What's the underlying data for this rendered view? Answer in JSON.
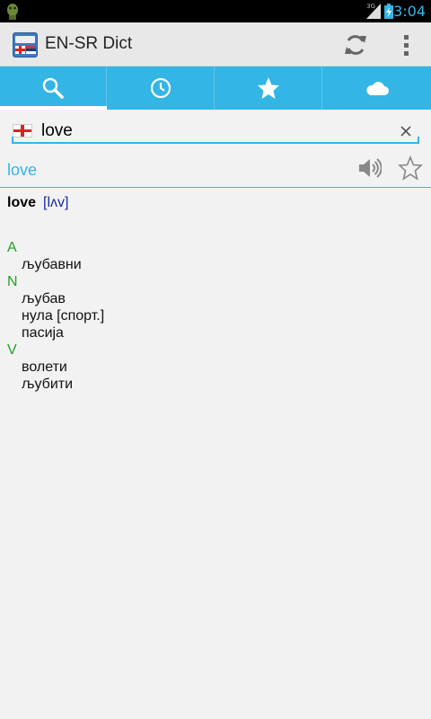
{
  "status_bar": {
    "network": "3G",
    "time": "3:04"
  },
  "action_bar": {
    "title": "EN-SR Dict"
  },
  "tabs": [
    "search",
    "history",
    "favorites",
    "cloud"
  ],
  "search": {
    "value": "love"
  },
  "result": {
    "word": "love",
    "headword": "love",
    "transcription": "[lʌv]",
    "senses": [
      {
        "pos": "A",
        "translations": [
          "љубавни"
        ]
      },
      {
        "pos": "N",
        "translations": [
          "љубав",
          "нула [спорт.]",
          "пасија"
        ]
      },
      {
        "pos": "V",
        "translations": [
          "волети",
          "љубити"
        ]
      }
    ]
  },
  "colors": {
    "accent": "#33b5e5",
    "pos": "#22a322",
    "transcription": "#1a2aa0"
  }
}
